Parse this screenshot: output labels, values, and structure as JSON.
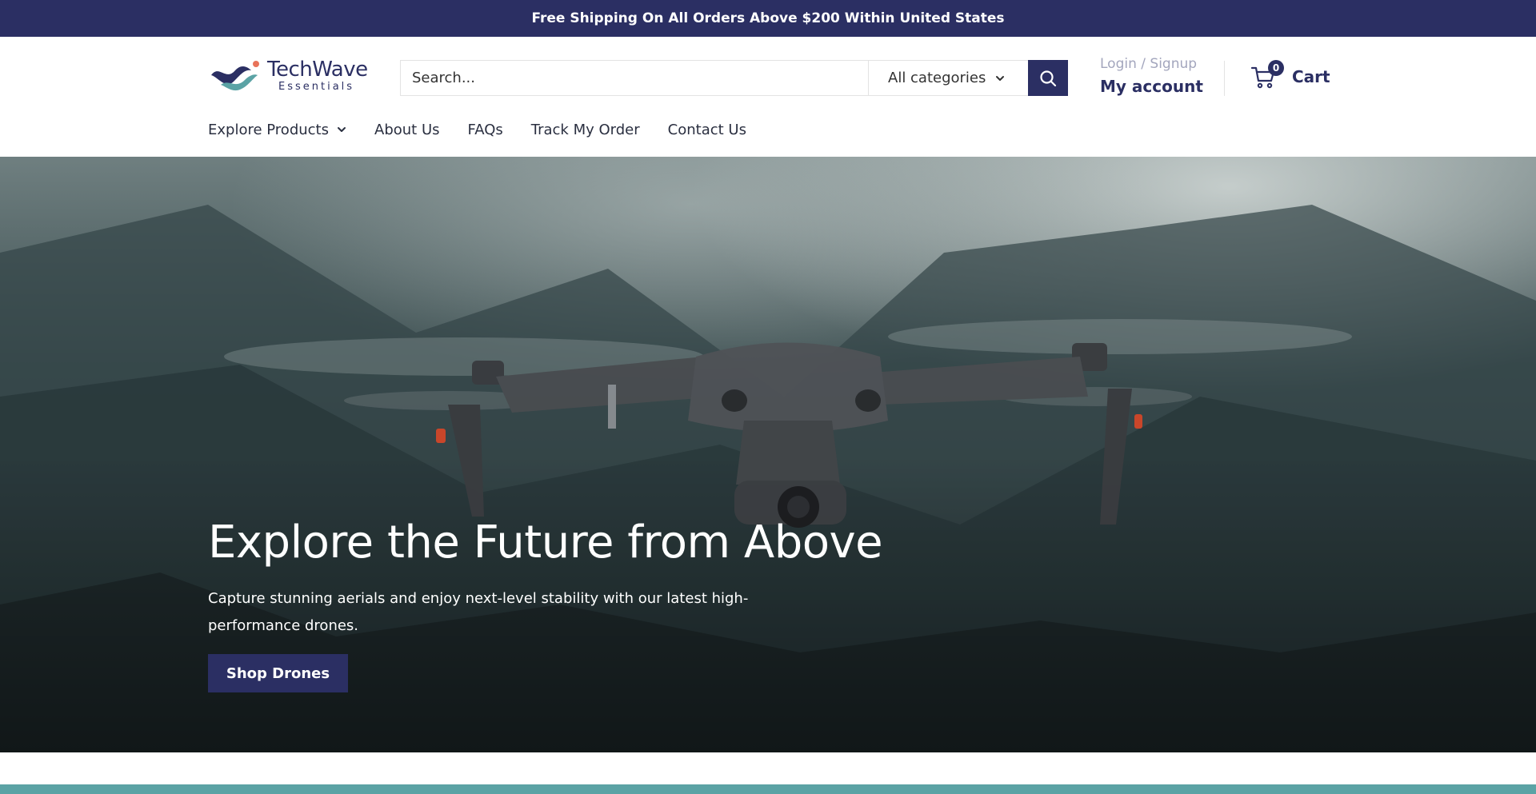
{
  "announcement": {
    "text": "Free Shipping On All Orders Above $200 Within United States"
  },
  "header": {
    "logo": {
      "name": "TechWave",
      "tagline": "Essentials"
    },
    "search": {
      "placeholder": "Search...",
      "category": "All categories"
    },
    "account": {
      "login_label": "Login / Signup",
      "account_label": "My account"
    },
    "cart": {
      "count": "0",
      "label": "Cart"
    }
  },
  "nav": {
    "items": [
      {
        "label": "Explore Products"
      },
      {
        "label": "About Us"
      },
      {
        "label": "FAQs"
      },
      {
        "label": "Track My Order"
      },
      {
        "label": "Contact Us"
      }
    ]
  },
  "hero": {
    "title": "Explore the Future from Above",
    "subtitle": "Capture stunning aerials and enjoy next-level stability with our latest high-performance drones.",
    "button_label": "Shop Drones"
  },
  "colors": {
    "brand": "#2b2f63",
    "accent_teal": "#5ba3a5",
    "text_muted": "#a3a6bd"
  },
  "icons": {
    "search": "search-icon",
    "cart": "cart-icon",
    "chevron": "chevron-down-icon"
  }
}
